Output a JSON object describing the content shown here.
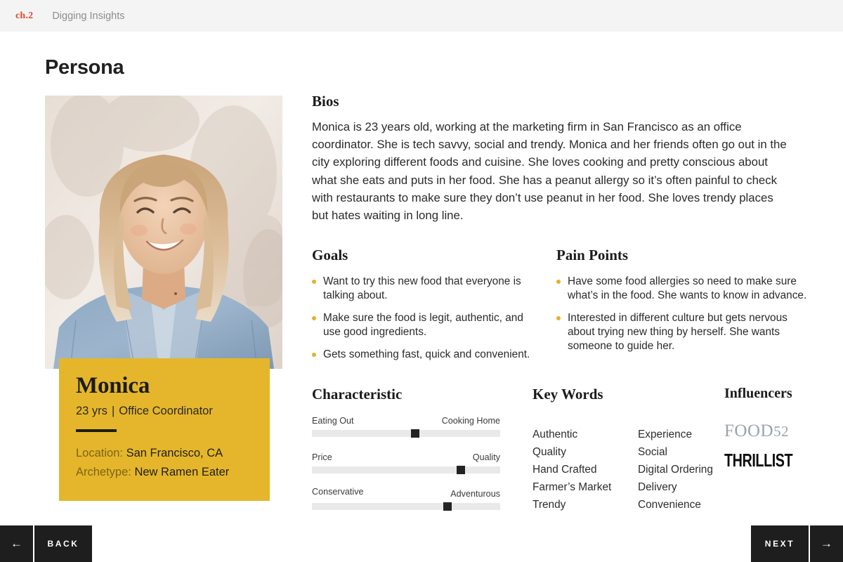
{
  "header": {
    "chapter_tag": "ch.2",
    "chapter_title": "Digging Insights"
  },
  "page_title": "Persona",
  "persona_card": {
    "name": "Monica",
    "age": "23 yrs",
    "separator": "|",
    "role": "Office Coordinator",
    "location_label": "Location:",
    "location_value": "San Francisco, CA",
    "archetype_label": "Archetype:",
    "archetype_value": "New Ramen Eater",
    "card_color": "#E5B62B"
  },
  "bios": {
    "heading": "Bios",
    "text": "Monica is 23 years old, working at the marketing firm in San Francisco as an office coordinator. She is tech savvy, social and trendy. Monica and her friends often go out in the city exploring different foods and cuisine. She loves cooking and pretty conscious about what she eats and puts in her food. She has a peanut allergy so it’s often painful to check with restaurants to make sure they don’t use peanut in her food. She loves trendy places but hates waiting in long line."
  },
  "goals": {
    "heading": "Goals",
    "items": [
      "Want to try this new food that everyone is talking about.",
      "Make sure the food is legit, authentic, and use good ingredients.",
      "Gets something fast, quick and convenient."
    ]
  },
  "pain_points": {
    "heading": "Pain Points",
    "items": [
      "Have some food allergies so need to make sure what’s in the food. She wants to know in advance.",
      "Interested in different culture but gets nervous about trying new thing by herself. She wants someone to guide her."
    ]
  },
  "characteristic": {
    "heading": "Characteristic",
    "sliders": [
      {
        "left_label": "Eating Out",
        "right_label": "Cooking Home",
        "value": 55
      },
      {
        "left_label": "Price",
        "right_label": "Quality",
        "value": 79
      },
      {
        "left_label": "Conservative",
        "right_label": "Adventurous",
        "value": 72
      }
    ]
  },
  "key_words": {
    "heading": "Key Words",
    "column_1": [
      "Authentic",
      "Quality",
      "Hand Crafted",
      "Farmer’s Market",
      "Trendy"
    ],
    "column_2": [
      "Experience",
      "Social",
      "Digital Ordering",
      "Delivery",
      "Convenience"
    ]
  },
  "influencers": {
    "heading": "Influencers",
    "logos": [
      {
        "name": "FOOD",
        "suffix": "52",
        "color": "#9AA3AD"
      },
      {
        "name": "THRILLIST",
        "color": "#0D0D0D"
      }
    ]
  },
  "navigation": {
    "back_label": "BACK",
    "back_arrow": "←",
    "next_label": "NEXT",
    "next_arrow": "→"
  },
  "accent_colors": {
    "chapter": "#E2492A",
    "bullet": "#E0B231",
    "gold": "#E5B62B",
    "nav_bar": "#1E1E1E"
  }
}
